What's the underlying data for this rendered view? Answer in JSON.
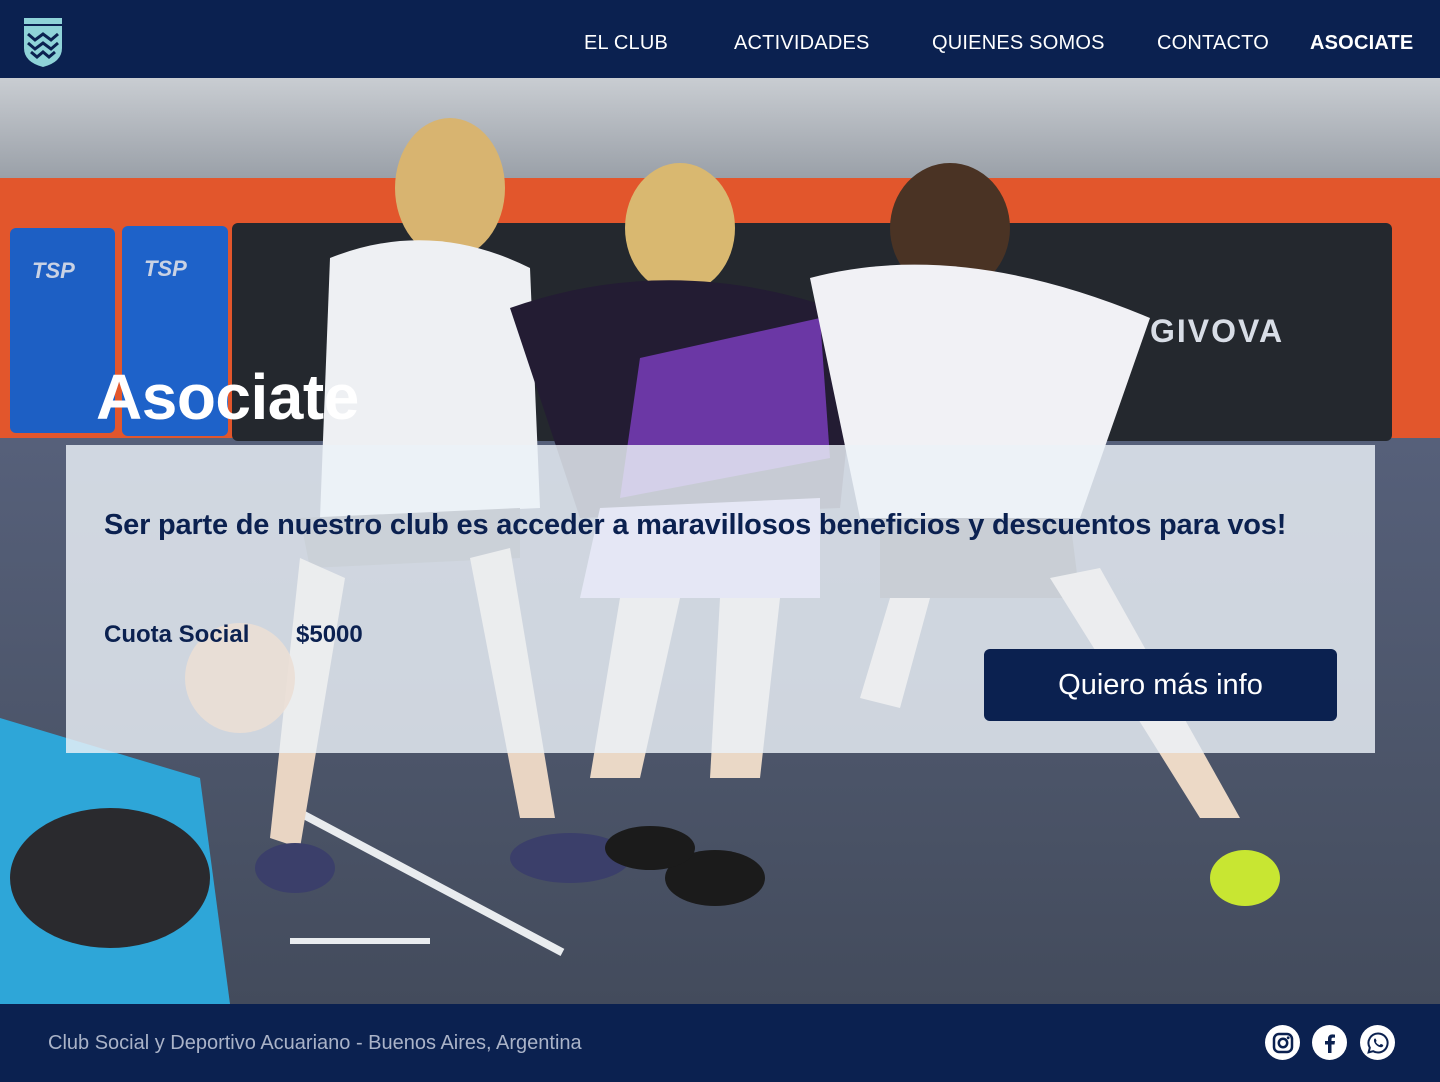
{
  "header": {
    "nav": [
      {
        "label": "EL CLUB",
        "active": false
      },
      {
        "label": "ACTIVIDADES",
        "active": false
      },
      {
        "label": "QUIENES SOMOS",
        "active": false
      },
      {
        "label": "CONTACTO",
        "active": false
      },
      {
        "label": "ASOCIATE",
        "active": true
      }
    ]
  },
  "hero": {
    "title": "Asociate",
    "background_text": {
      "pad1": "TSP",
      "pad2": "TSP",
      "banner": "GIVOVA"
    }
  },
  "card": {
    "text": "Ser parte de nuestro club es acceder a maravillosos beneficios y descuentos para vos!",
    "fee_label": "Cuota Social",
    "fee_value": "$5000",
    "cta_label": "Quiero más info"
  },
  "footer": {
    "text": "Club Social y Deportivo Acuariano - Buenos Aires, Argentina",
    "social": [
      "instagram-icon",
      "facebook-icon",
      "whatsapp-icon"
    ]
  },
  "colors": {
    "navy": "#0b2150",
    "white": "#ffffff",
    "card_bg": "#ebf2f8",
    "footer_text": "#aab3c8"
  }
}
